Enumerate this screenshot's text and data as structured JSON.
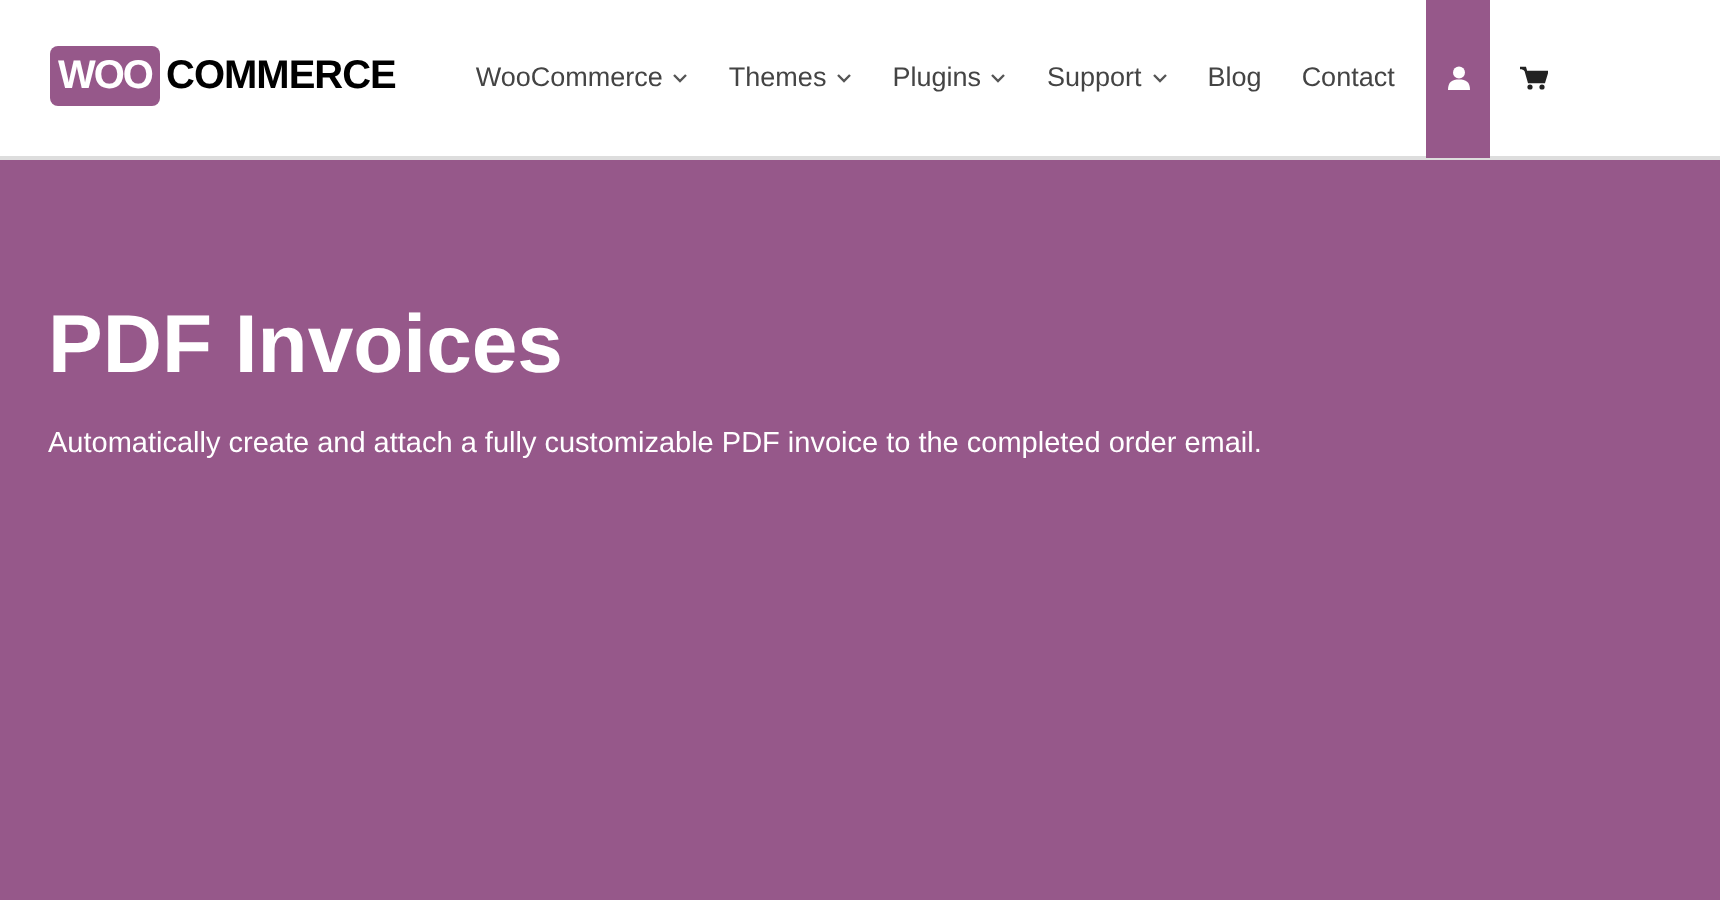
{
  "logo": {
    "badge": "WOO",
    "wordmark": "COMMERCE"
  },
  "nav": [
    {
      "label": "WooCommerce",
      "dropdown": true
    },
    {
      "label": "Themes",
      "dropdown": true
    },
    {
      "label": "Plugins",
      "dropdown": true
    },
    {
      "label": "Support",
      "dropdown": true
    },
    {
      "label": "Blog",
      "dropdown": false
    },
    {
      "label": "Contact",
      "dropdown": false
    }
  ],
  "icon_buttons": [
    {
      "kind": "account",
      "selected": true
    },
    {
      "kind": "cart",
      "selected": false
    }
  ],
  "hero": {
    "title": "PDF Invoices",
    "subtitle": "Automatically create and attach a fully customizable PDF invoice to the completed order email."
  }
}
